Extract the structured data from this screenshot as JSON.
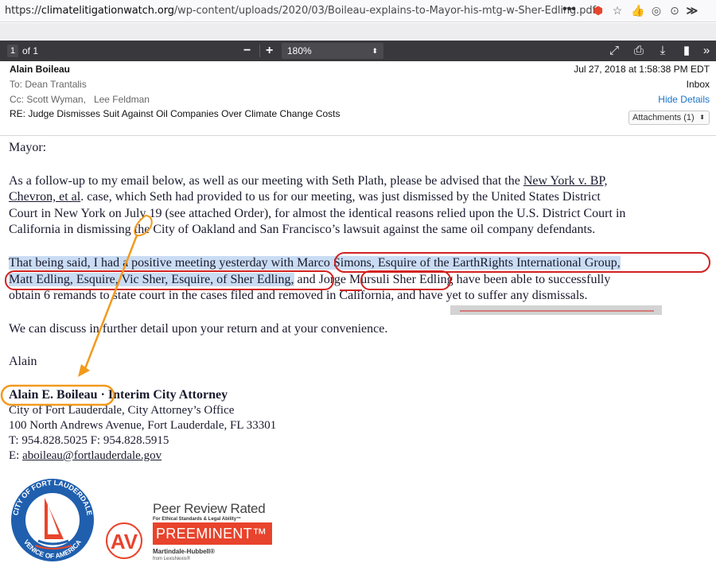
{
  "browser": {
    "url_prefix": "https://",
    "url_host": "climatelitigationwatch.org",
    "url_path": "/wp-content/uploads/2020/03/Boileau-explains-to-Mayor-his-mtg-w-Sher-Edling.pdf",
    "menu_dots": "•••",
    "overflow": "≫"
  },
  "pdf_toolbar": {
    "page_number": "1",
    "page_of": "of 1",
    "zoom_out": "−",
    "zoom_in": "+",
    "zoom_value": "180%"
  },
  "email": {
    "from": "Alain Boileau",
    "to": "To:  Dean Trantalis",
    "cc_label": "Cc:  Scott Wyman,",
    "cc_second": "Lee Feldman",
    "subject": "RE: Judge Dismisses Suit Against Oil Companies Over Climate Change Costs",
    "date": "Jul 27, 2018 at 1:58:38 PM EDT",
    "mailbox": "Inbox",
    "hide_details": "Hide Details",
    "attachments": "Attachments (1)"
  },
  "letter": {
    "salutation": "Mayor:",
    "p1_l1a": "As a follow-up to my email below, as well as our meeting with Seth Plath, please be advised that the ",
    "p1_l1b": "New York v. BP,",
    "p1_l2a": "Chevron, et al",
    "p1_l2b": ". case, which Seth had provided to us for our meeting, was just dismissed by the United States District",
    "p1_l3": "Court in New York on July 19 (see attached Order), for almost the identical reasons relied upon the U.S. District Court in",
    "p1_l4": "California in dismissing the City of Oakland and San Francisco’s  lawsuit against the same oil company defendants.",
    "p2_l1a": "That being said, I  had a positive meeting yesterday with ",
    "p2_l1b": "Marco Simons, Esquire of the EarthRights International Group,",
    "p2_l2a": " Matt Edling, Esquire, Vic Sher, Esquire, of Sher Edling,",
    "p2_l2b": "  and ",
    "p2_l2c": "Jorge Mursuli",
    "p2_l2d": "  Sher Edling have been able to successfully",
    "p2_l3": "obtain 6 remands to state court in the cases filed and removed in California, and have yet to suffer any dismissals.",
    "p3": "We can discuss in further detail upon your return and at your convenience.",
    "closing": "Alain"
  },
  "signature": {
    "name": "Alain E. Boileau",
    "title": " · Interim City Attorney",
    "line1": "City of Fort Lauderdale, City Attorney’s Office",
    "line2": "100 North Andrews Avenue, Fort Lauderdale, FL 33301",
    "line3": "T: 954.828.5025  F: 954.828.5915",
    "email_label": "E: ",
    "email": "aboileau@fortlauderdale.gov"
  },
  "logos": {
    "seal_top": "CITY OF FORT LAUDERDALE",
    "seal_bottom": "VENICE OF AMERICA",
    "av": "AV",
    "peer_title": "Peer Review Rated",
    "peer_sub": "For Ethical Standards & Legal Ability™",
    "preeminent": "PREEMINENT™",
    "martindale": "Martindale-Hubbell®",
    "lexis": "from LexisNexis®"
  },
  "colors": {
    "annotation_red": "#d22222",
    "annotation_orange": "#f29a1c",
    "selection_blue": "#c9dcf3",
    "pdf_toolbar": "#38383d",
    "preeminent_red": "#e8432c",
    "seal_blue": "#1f5fae"
  }
}
